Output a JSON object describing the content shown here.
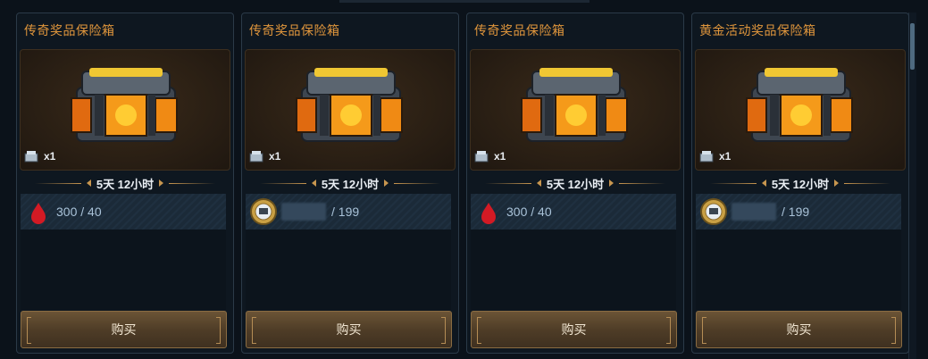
{
  "cards": [
    {
      "title": "传奇奖品保险箱",
      "qty": "x1",
      "timer": "5天 12小时",
      "currency": "blood",
      "cost": "300 / 40",
      "buy": "购买"
    },
    {
      "title": "传奇奖品保险箱",
      "qty": "x1",
      "timer": "5天 12小时",
      "currency": "gold-medal",
      "cost": "/ 199",
      "buy": "购买"
    },
    {
      "title": "传奇奖品保险箱",
      "qty": "x1",
      "timer": "5天 12小时",
      "currency": "blood",
      "cost": "300 / 40",
      "buy": "购买"
    },
    {
      "title": "黄金活动奖品保险箱",
      "qty": "x1",
      "timer": "5天 12小时",
      "currency": "gold-medal",
      "cost": "/ 199",
      "buy": "购买"
    }
  ],
  "colors": {
    "title": "#e0963c",
    "accent": "#c8964f",
    "button": "#5a4730"
  }
}
